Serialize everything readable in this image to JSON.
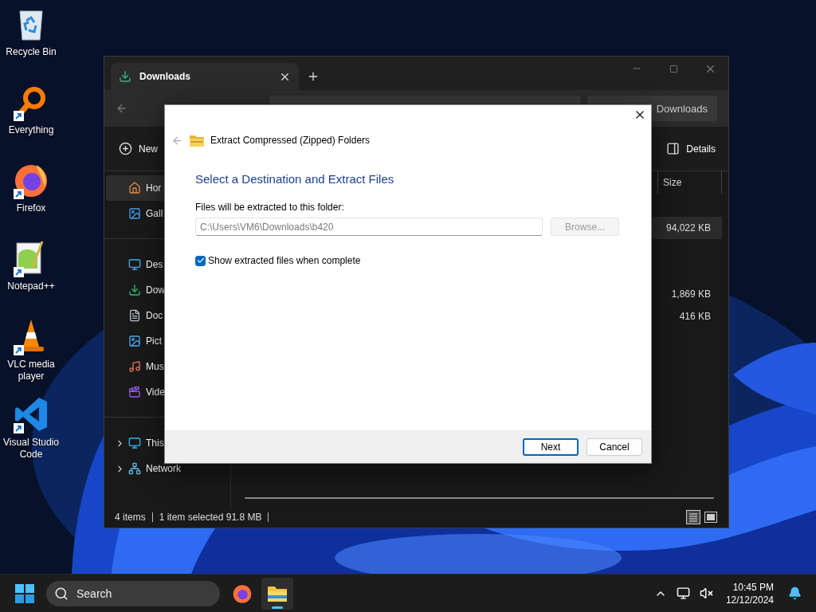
{
  "desktop_icons": [
    {
      "label": "Recycle Bin",
      "kind": "recycle",
      "shortcut": false
    },
    {
      "label": "Everything",
      "kind": "everything",
      "shortcut": true
    },
    {
      "label": "Firefox",
      "kind": "firefox",
      "shortcut": true
    },
    {
      "label": "Notepad++",
      "kind": "notepad",
      "shortcut": true
    },
    {
      "label": "VLC media player",
      "kind": "vlc",
      "shortcut": true
    },
    {
      "label": "Visual Studio Code",
      "kind": "vscode",
      "shortcut": true
    }
  ],
  "explorer": {
    "tab": {
      "title": "Downloads"
    },
    "search": {
      "placeholder": "Downloads"
    },
    "command_bar": {
      "new": "New",
      "details": "Details"
    },
    "sidebar": {
      "items": [
        {
          "label": "Hor",
          "kind": "home",
          "selected": true,
          "expandable": false,
          "group_start": false
        },
        {
          "label": "Gall",
          "kind": "gallery",
          "selected": false,
          "expandable": false,
          "group_start": false
        },
        {
          "label": "Des",
          "kind": "desktop",
          "selected": false,
          "expandable": false,
          "group_start": true
        },
        {
          "label": "Dow",
          "kind": "downloads",
          "selected": false,
          "expandable": false,
          "group_start": false
        },
        {
          "label": "Doc",
          "kind": "documents",
          "selected": false,
          "expandable": false,
          "group_start": false
        },
        {
          "label": "Pict",
          "kind": "pictures",
          "selected": false,
          "expandable": false,
          "group_start": false
        },
        {
          "label": "Mus",
          "kind": "music",
          "selected": false,
          "expandable": false,
          "group_start": false
        },
        {
          "label": "Vide",
          "kind": "videos",
          "selected": false,
          "expandable": false,
          "group_start": false
        },
        {
          "label": "This",
          "kind": "pc",
          "selected": false,
          "expandable": true,
          "group_start": true
        },
        {
          "label": "Network",
          "kind": "network",
          "selected": false,
          "expandable": true,
          "group_start": false
        }
      ]
    },
    "columns": [
      {
        "label": "Size"
      }
    ],
    "row_groups": [
      {
        "rows": [
          {
            "size": "94,022 KB",
            "selected": true
          }
        ]
      },
      {
        "rows": [
          {
            "size": "1,869 KB",
            "selected": false
          },
          {
            "size": "416 KB",
            "selected": false
          }
        ]
      }
    ],
    "status_bar": {
      "count": "4 items",
      "selection": "1 item selected 91.8 MB"
    }
  },
  "dialog": {
    "title": "Extract Compressed (Zipped) Folders",
    "heading": "Select a Destination and Extract Files",
    "field_label": "Files will be extracted to this folder:",
    "path": "C:\\Users\\VM6\\Downloads\\b420",
    "browse": {
      "label": "Browse...",
      "disabled": true
    },
    "show_files": {
      "label": "Show extracted files when complete",
      "checked": true
    },
    "buttons": [
      {
        "label": "Next",
        "default": true
      },
      {
        "label": "Cancel",
        "default": false
      }
    ]
  },
  "taskbar": {
    "search": {
      "placeholder": "Search"
    },
    "apps": [
      {
        "kind": "firefox",
        "active": false
      },
      {
        "kind": "explorer",
        "active": true
      }
    ],
    "time": "10:45 PM",
    "date": "12/12/2024"
  }
}
